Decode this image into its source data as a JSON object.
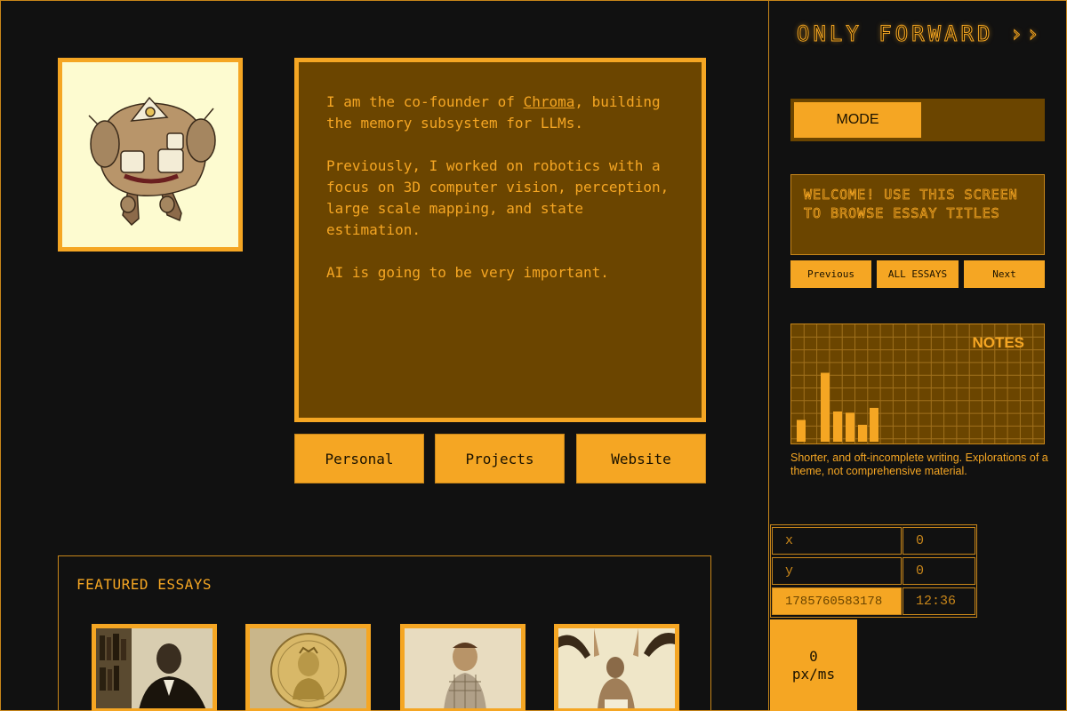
{
  "bio": {
    "line1_pre": "I am the co-founder of ",
    "link": "Chroma",
    "line1_post": ", building the memory subsystem for LLMs.",
    "para2": "Previously, I worked on robotics with a focus on 3D computer vision, perception, large scale mapping, and state estimation.",
    "para3": "AI is going to be very important."
  },
  "tabs": [
    "Personal",
    "Projects",
    "Website"
  ],
  "featured": {
    "title": "FEATURED ESSAYS"
  },
  "logo": "ONLY FORWARD ››",
  "mode": {
    "label": "MODE"
  },
  "welcome": "WELCOME! USE THIS SCREEN TO BROWSE ESSAY TITLES",
  "nav": {
    "previous": "Previous",
    "all": "ALL ESSAYS",
    "next": "Next"
  },
  "notes": {
    "title": "NOTES",
    "description": "Shorter, and oft-incomplete writing. Explorations of a theme, not comprehensive material.",
    "bars": [
      0.18,
      0.57,
      0.25,
      0.24,
      0.14,
      0.28
    ]
  },
  "coords": {
    "x_label": "x",
    "x_value": "0",
    "y_label": "y",
    "y_value": "0",
    "timestamp": "1785760583178",
    "time": "12:36"
  },
  "speed": {
    "value": "0",
    "unit": "px/ms"
  },
  "colors": {
    "accent": "#f5a623",
    "dark_amber": "#6b4500",
    "background": "#111111"
  }
}
